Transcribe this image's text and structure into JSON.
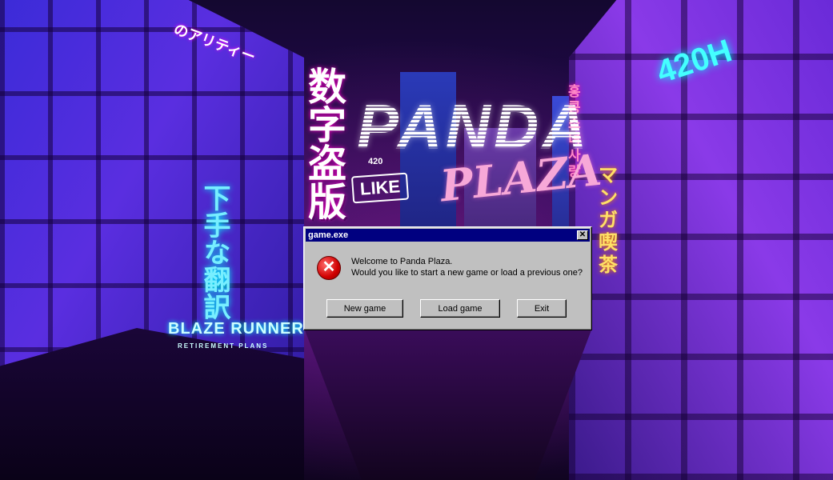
{
  "background": {
    "signs": {
      "chinese_vertical": "数字盗版",
      "japanese_vertical": "下手な翻訳",
      "japanese_top": "のアリティー",
      "like": "LIKE",
      "small_420": "420",
      "blaze_runner": "BLAZE RUNNER",
      "blaze_runner_sub": "RETIREMENT PLANS",
      "manga_cafe": "マンガ喫茶",
      "korean": "홍콩소녀사랑",
      "neon_420h": "420H"
    }
  },
  "logo": {
    "line1": "PANDA",
    "line2": "PLAZA"
  },
  "dialog": {
    "title": "game.exe",
    "close_glyph": "✕",
    "icon": "error-icon",
    "icon_glyph": "✕",
    "message_line1": "Welcome to Panda Plaza.",
    "message_line2": "Would you like to start a new game or load a previous one?",
    "buttons": {
      "new_game": "New game",
      "load_game": "Load game",
      "exit": "Exit"
    }
  }
}
